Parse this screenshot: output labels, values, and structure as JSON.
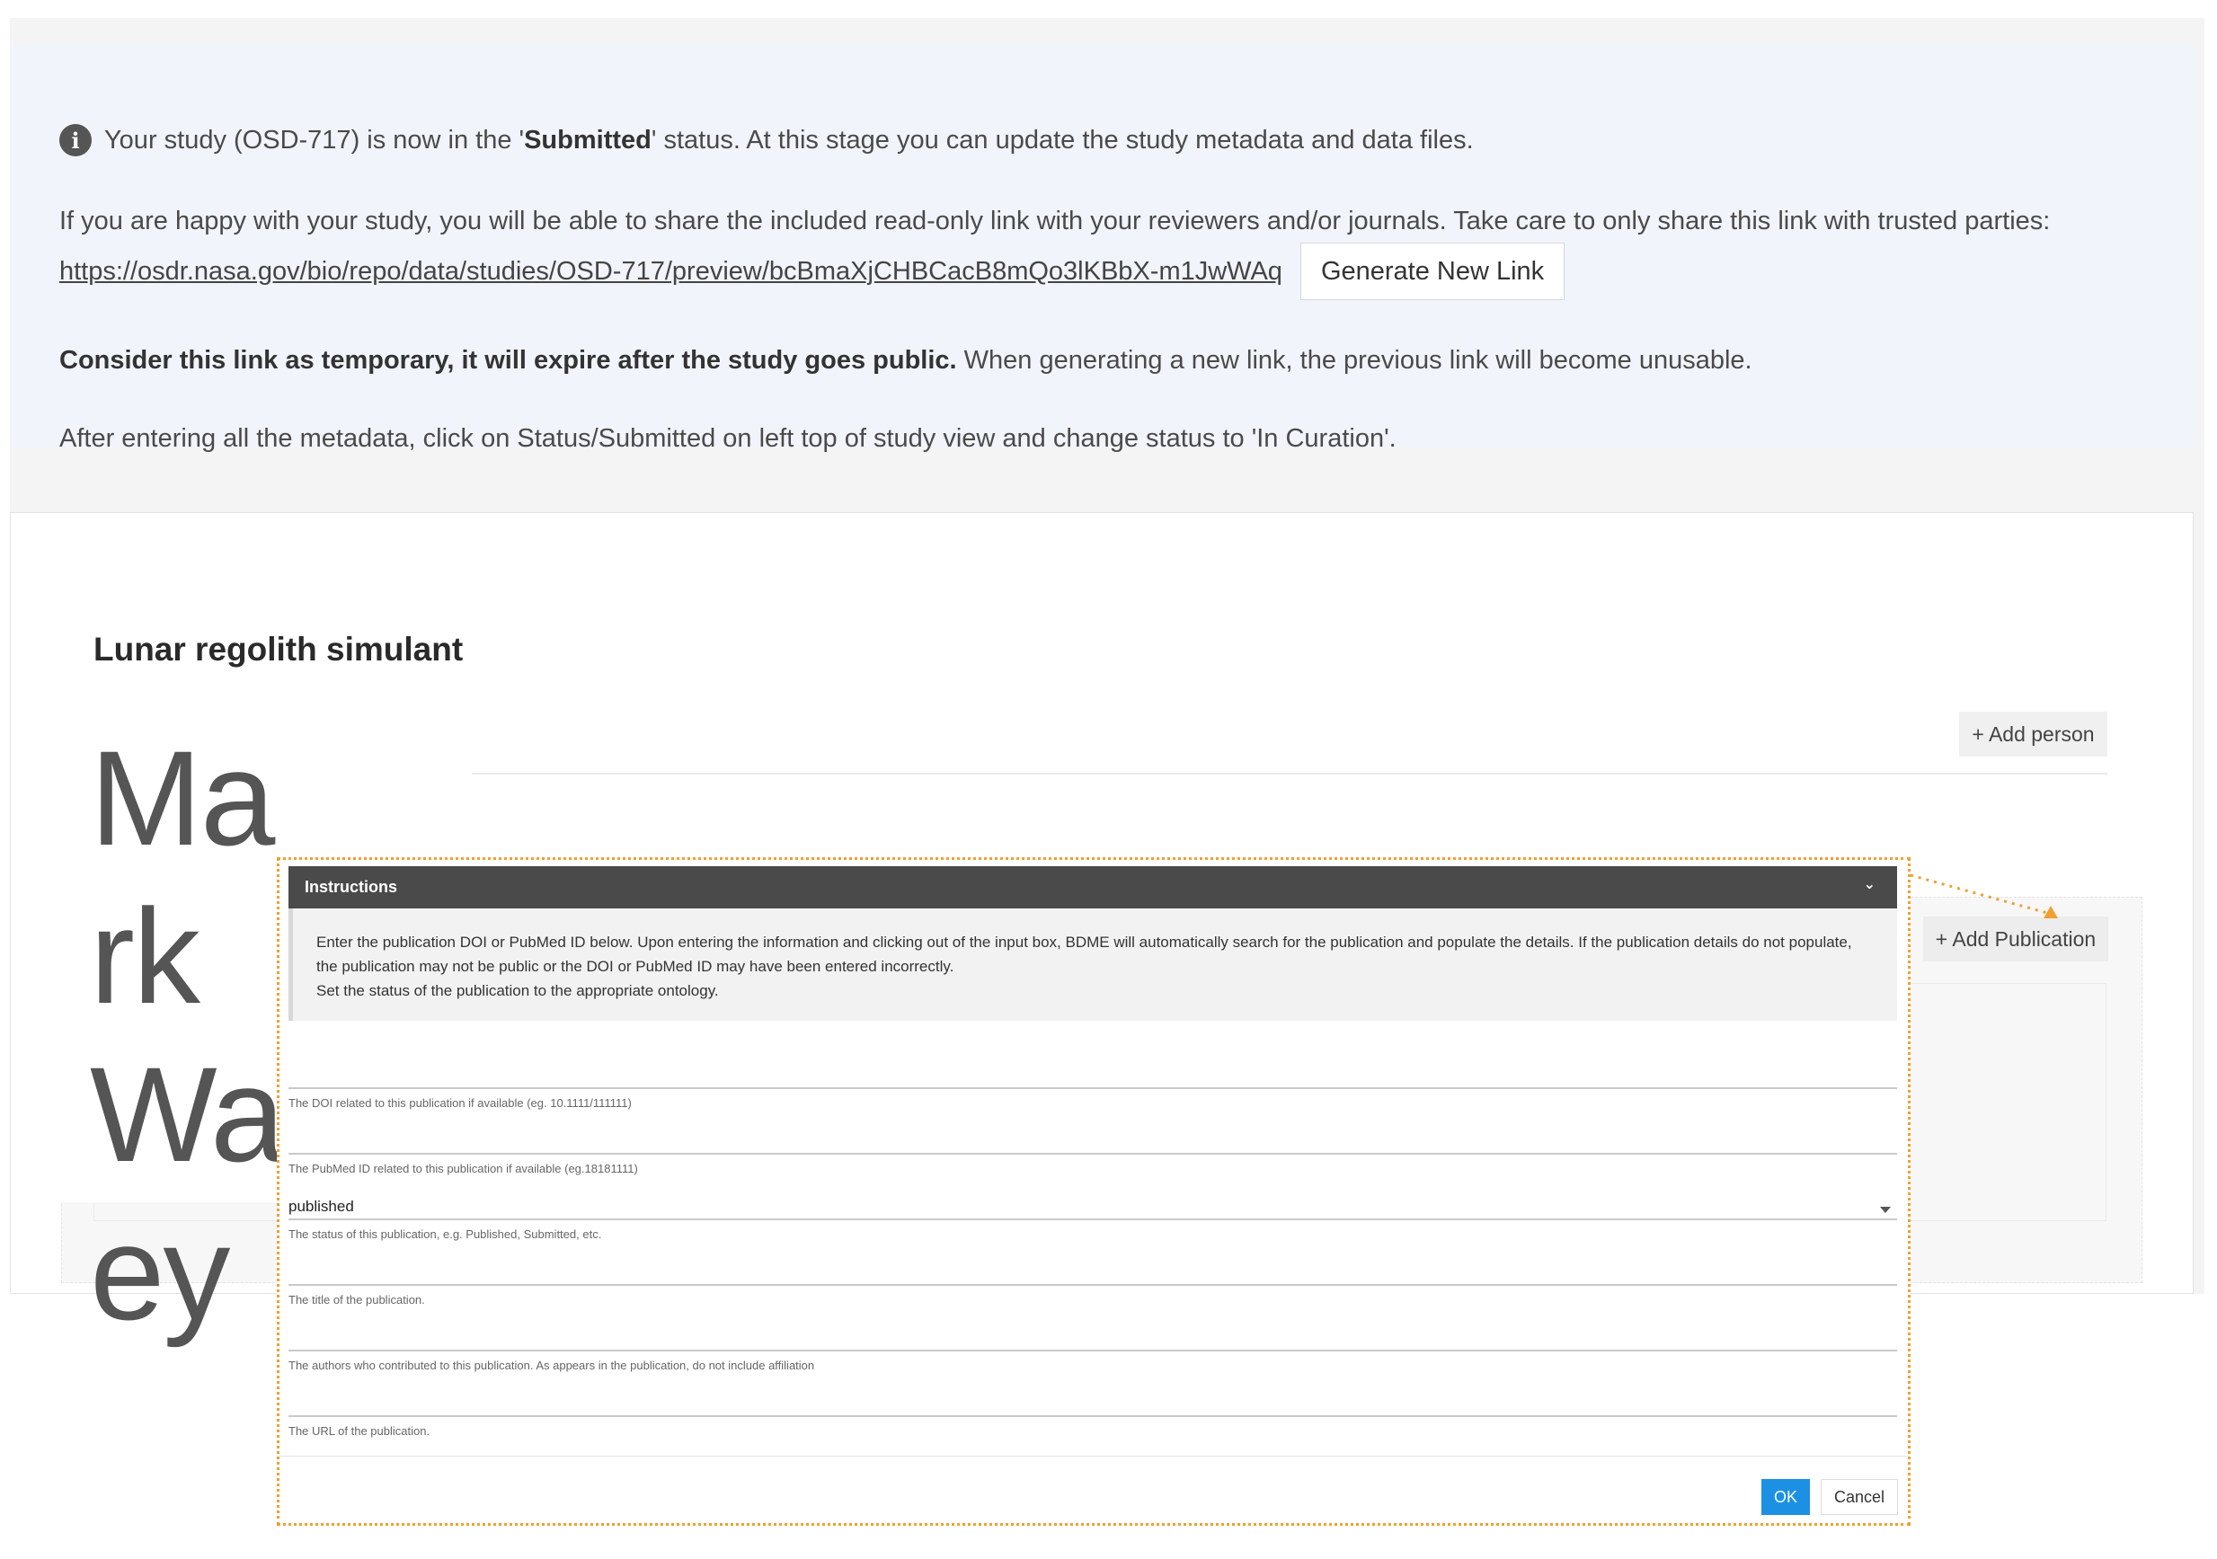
{
  "notice": {
    "line1_prefix": "Your study (OSD-717) is now in the '",
    "line1_bold": "Submitted",
    "line1_suffix": "' status. At this stage you can update the study metadata and data files.",
    "line2": "If you are happy with your study, you will be able to share the included read-only link with your reviewers and/or journals. Take care to only share this link with trusted parties:",
    "preview_link": "https://osdr.nasa.gov/bio/repo/data/studies/OSD-717/preview/bcBmaXjCHBCacB8mQo3lKBbX-m1JwWAq",
    "generate_button": "Generate New Link",
    "line3_bold": "Consider this link as temporary, it will expire after the study goes public.",
    "line3_rest": " When generating a new link, the previous link will become unusable.",
    "line4": "After entering all the metadata, click on Status/Submitted on left top of study view and change status to 'In Curation'."
  },
  "study": {
    "title": "Lunar regolith simulant",
    "person_name": "Mark Waey",
    "add_person": "+ Add person",
    "add_publication": "+ Add Publication"
  },
  "dialog": {
    "instructions_title": "Instructions",
    "instructions_text_1": "Enter the publication DOI or PubMed ID below. Upon entering the information and clicking out of the input box, BDME will automatically search for the publication and populate the details. If the publication details do not populate, the publication may not be public or the DOI or PubMed ID may have been entered incorrectly.",
    "instructions_text_2": "Set the status of the publication to the appropriate ontology.",
    "fields": {
      "doi_help": "The DOI related to this publication if available (eg. 10.1111/111111)",
      "pubmed_help": "The PubMed ID related to this publication if available (eg.18181111)",
      "status_value": "published",
      "status_help": "The status of this publication, e.g. Published, Submitted, etc.",
      "title_help": "The title of the publication.",
      "authors_help": "The authors who contributed to this publication. As appears in the publication, do not include affiliation",
      "url_help": "The URL of the publication."
    },
    "ok": "OK",
    "cancel": "Cancel"
  },
  "colors": {
    "notice_bg": "#f1f4fb",
    "ok_button": "#1c91e3",
    "highlight_border": "#f0a030",
    "instructions_bar": "#4a4a4a"
  }
}
